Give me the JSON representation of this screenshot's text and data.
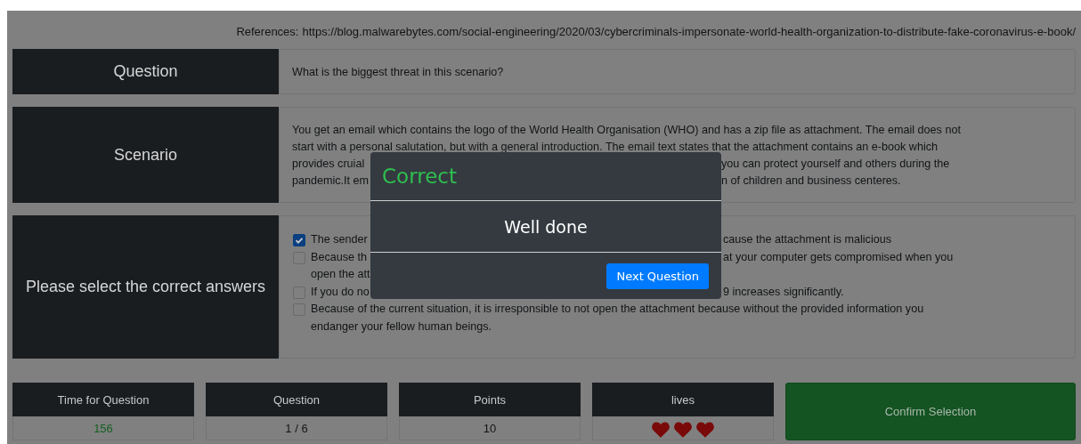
{
  "references": {
    "label": "References:",
    "url": "https://blog.malwarebytes.com/social-engineering/2020/03/cybercriminals-impersonate-world-health-organization-to-distribute-fake-coronavirus-e-book/"
  },
  "question": {
    "label": "Question",
    "text": "What is the biggest threat in this scenario?"
  },
  "scenario": {
    "label": "Scenario",
    "lines": [
      {
        "kind": "full",
        "left": "You get an email which contains the logo of the World Health Organisation (WHO) and has a zip file as attachment. The email does not"
      },
      {
        "kind": "full",
        "left": "start with a personal salutation, but with a general introduction. The email text states that the attachment contains an e-book which"
      },
      {
        "kind": "split",
        "left": "provides cruial",
        "right": "you can protect yourself and others during the"
      },
      {
        "kind": "split",
        "left": "pandemic.It em",
        "right": "n of children and business centeres."
      }
    ]
  },
  "answers": {
    "label": "Please select the correct answers",
    "items": [
      {
        "checked": true,
        "lines": [
          {
            "kind": "split",
            "left": "The sender",
            "right": "cause the attachment is malicious"
          }
        ]
      },
      {
        "checked": false,
        "lines": [
          {
            "kind": "split",
            "left": "Because th",
            "right": "at your computer gets compromised when you"
          },
          {
            "kind": "split",
            "left": "open the att"
          }
        ]
      },
      {
        "checked": false,
        "lines": [
          {
            "kind": "split",
            "left": "If you do no",
            "right": "9 increases significantly."
          }
        ]
      },
      {
        "checked": false,
        "lines": [
          {
            "kind": "full",
            "left": "Because of the current situation, it is irresponsible to not open the attachment because without the provided information you"
          },
          {
            "kind": "full",
            "left": "endanger your fellow human beings."
          }
        ]
      }
    ]
  },
  "stats": [
    {
      "kind": "timer",
      "label": "Time for Question",
      "value": "156"
    },
    {
      "kind": "text",
      "label": "Question",
      "value": "1 / 6"
    },
    {
      "kind": "text",
      "label": "Points",
      "value": "10"
    },
    {
      "kind": "hearts",
      "label": "lives",
      "stars": 3
    }
  ],
  "confirm_button": "Confirm Selection",
  "modal": {
    "title": "Correct",
    "message": "Well done",
    "button": "Next Question"
  }
}
